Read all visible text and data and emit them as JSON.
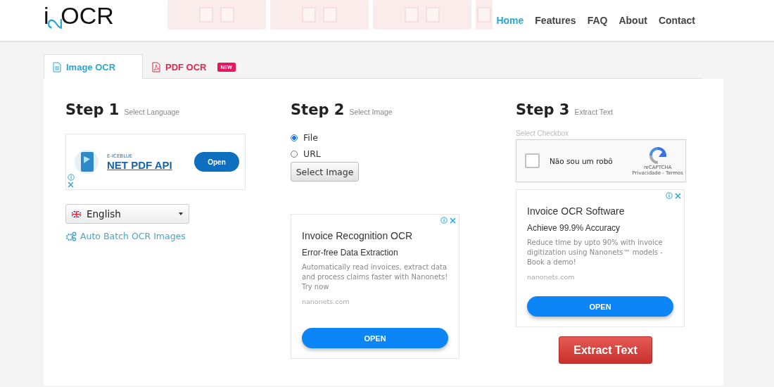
{
  "header": {
    "logo": {
      "prefix": "i",
      "mark": "2",
      "suffix": "OCR"
    },
    "banners": [
      {
        "kind": "full"
      },
      {
        "kind": "full"
      },
      {
        "kind": "full"
      },
      {
        "kind": "partial"
      }
    ],
    "nav": [
      {
        "label": "Home",
        "selected": true
      },
      {
        "label": "Features",
        "selected": false
      },
      {
        "label": "FAQ",
        "selected": false
      },
      {
        "label": "About",
        "selected": false
      },
      {
        "label": "Contact",
        "selected": false
      }
    ]
  },
  "tabs": [
    {
      "label": "Image OCR",
      "selected": true,
      "kind": "image"
    },
    {
      "label": "PDF OCR",
      "selected": false,
      "kind": "pdf",
      "badge": "NEW"
    }
  ],
  "steps": [
    {
      "title": "Step 1",
      "subtitle": "Select Language"
    },
    {
      "title": "Step 2",
      "subtitle": "Select Image"
    },
    {
      "title": "Step 3",
      "subtitle": "Extract Text"
    }
  ],
  "step1": {
    "banner_ad": {
      "brand": "E-ICEBLUE",
      "headline": "NET PDF API",
      "button": "Open"
    },
    "language_select": {
      "value": "English"
    },
    "batch_link": "Auto Batch OCR Images"
  },
  "step2": {
    "sources": [
      {
        "label": "File",
        "selected": true
      },
      {
        "label": "URL",
        "selected": false
      }
    ],
    "select_button": "Select Image",
    "ad": {
      "title": "Invoice Recognition OCR",
      "subtitle": "Error-free Data Extraction",
      "body": "Automatically read invoices, extract data and process claims faster with Nanonets! Try now",
      "domain": "nanonets.com",
      "button": "OPEN"
    }
  },
  "step3": {
    "checkbox_label": "Select Checkbox",
    "captcha": {
      "label": "Não sou um robô",
      "checked": false,
      "brand": "reCAPTCHA",
      "links": "Privacidade - Termos"
    },
    "ad": {
      "title": "Invoice OCR Software",
      "subtitle": "Achieve 99.9% Accuracy",
      "body": "Reduce time by upto 90% with invoice digitization using Nanonets™ models - Book a demo!",
      "domain": "nanonets.com",
      "button": "OPEN"
    },
    "extract_button": "Extract Text"
  }
}
